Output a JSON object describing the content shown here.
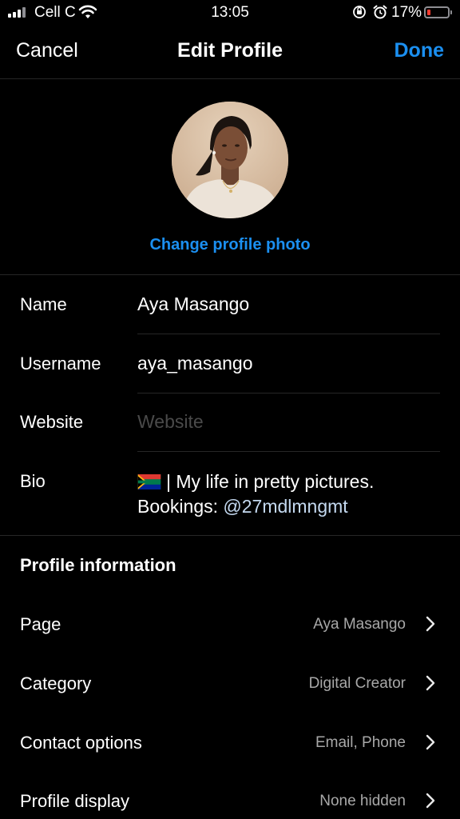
{
  "status_bar": {
    "carrier": "Cell C",
    "time": "13:05",
    "battery_percent": "17%",
    "battery_level": 0.17,
    "battery_color": "#ff3b30"
  },
  "nav": {
    "cancel_label": "Cancel",
    "title": "Edit Profile",
    "done_label": "Done",
    "accent_color": "#1b8ff0"
  },
  "profile": {
    "change_photo_label": "Change profile photo"
  },
  "fields": {
    "name": {
      "label": "Name",
      "value": "Aya Masango"
    },
    "username": {
      "label": "Username",
      "value": "aya_masango"
    },
    "website": {
      "label": "Website",
      "value": "",
      "placeholder": "Website"
    },
    "bio": {
      "label": "Bio",
      "line1": "| My life in pretty pictures.",
      "line2_prefix": "Bookings: ",
      "mention": "@27mdlmngmt",
      "flag": "south-africa-flag"
    }
  },
  "profile_information": {
    "title": "Profile information",
    "rows": [
      {
        "label": "Page",
        "value": "Aya Masango"
      },
      {
        "label": "Category",
        "value": "Digital Creator"
      },
      {
        "label": "Contact options",
        "value": "Email, Phone"
      },
      {
        "label": "Profile display",
        "value": "None hidden"
      }
    ]
  }
}
